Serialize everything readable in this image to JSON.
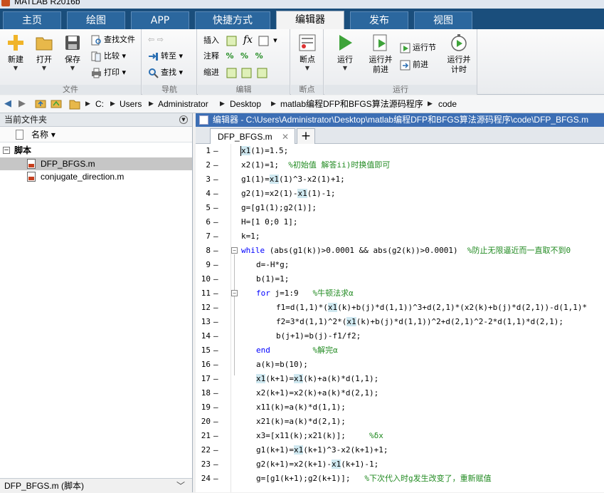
{
  "window": {
    "title": "MATLAB R2016b"
  },
  "tabs": [
    "主页",
    "绘图",
    "APP",
    "快捷方式",
    "编辑器",
    "发布",
    "视图"
  ],
  "ribbon": {
    "file": {
      "label": "文件",
      "new": "新建",
      "open": "打开",
      "save": "保存",
      "find_files": "查找文件",
      "compare": "比较",
      "print": "打印"
    },
    "nav": {
      "label": "导航",
      "goto": "转至",
      "find": "查找"
    },
    "edit": {
      "label": "编辑",
      "insert": "插入",
      "comment": "注释",
      "indent": "缩进"
    },
    "breakpoints": {
      "label": "断点",
      "btn": "断点"
    },
    "run": {
      "label": "运行",
      "run": "运行",
      "run_advance": "运行并\n前进",
      "run_section": "运行节",
      "advance": "前进",
      "run_time": "运行并\n计时"
    }
  },
  "address": [
    "C:",
    "Users",
    "Administrator",
    "Desktop",
    "matlab编程DFP和BFGS算法源码程序",
    "code"
  ],
  "left_panel": {
    "title": "当前文件夹",
    "header": "名称 ▾",
    "section": "脚本",
    "files": [
      "DFP_BFGS.m",
      "conjugate_direction.m"
    ],
    "status": "DFP_BFGS.m  (脚本)"
  },
  "editor": {
    "title": "编辑器 - C:\\Users\\Administrator\\Desktop\\matlab编程DFP和BFGS算法源码程序\\code\\DFP_BFGS.m",
    "tab": "DFP_BFGS.m",
    "lines": [
      "x1(1)=1.5;",
      "x2(1)=1;",
      "g1(1)=x1(1)^3-x2(1)+1;",
      "g2(1)=x2(1)-x1(1)-1;",
      "g=[g1(1);g2(1)];",
      "H=[1 0;0 1];",
      "k=1;",
      "(abs(g1(k))>0.0001 && abs(g2(k))>0.0001)",
      "d=-H*g;",
      "b(1)=1;",
      "j=1:9",
      "f1=d(1,1)*(x1(k)+b(j)*d(1,1))^3+d(2,1)*(x2(k)+b(j)*d(2,1))-d(1,1)*",
      "f2=3*d(1,1)^2*(x1(k)+b(j)*d(1,1))^2+d(2,1)^2-2*d(1,1)*d(2,1);",
      "b(j+1)=b(j)-f1/f2;",
      "",
      "a(k)=b(10);",
      "x1(k+1)=x1(k)+a(k)*d(1,1);",
      "x2(k+1)=x2(k)+a(k)*d(2,1);",
      "x11(k)=a(k)*d(1,1);",
      "x21(k)=a(k)*d(2,1);",
      "x3=[x11(k);x21(k)];",
      "g1(k+1)=x1(k+1)^3-x2(k+1)+1;",
      "g2(k+1)=x2(k+1)-x1(k+1)-1;",
      "g=[g1(k+1);g2(k+1)];"
    ],
    "keywords": {
      "while": "while",
      "for": "for",
      "end": "end"
    },
    "comments": {
      "l2": "%初始值 解答ii)时换值即可",
      "l8": "%防止无限逼近而一直取不到0",
      "l11": "%牛顿法求α",
      "l15": "%解完α",
      "l21": "%δx",
      "l24": "%下次代入时g发生改变了，重新赋值"
    }
  }
}
